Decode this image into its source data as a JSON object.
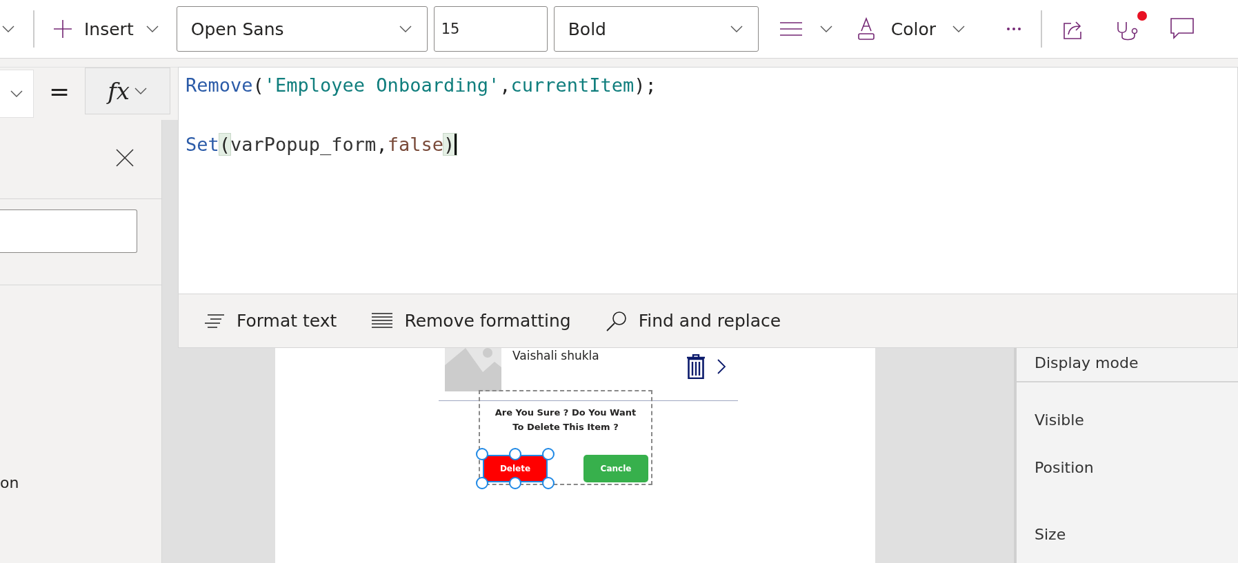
{
  "toolbar": {
    "insert_label": "Insert",
    "font": "Open Sans",
    "font_size": "15",
    "font_weight": "Bold",
    "color_label": "Color",
    "health_notification": true
  },
  "formula_bar": {
    "equals": "=",
    "fx": "fx",
    "lines": [
      {
        "tokens": [
          {
            "kind": "function",
            "text": "Remove"
          },
          {
            "kind": "punct",
            "text": "("
          },
          {
            "kind": "string",
            "text": "'Employee Onboarding'"
          },
          {
            "kind": "punct",
            "text": ","
          },
          {
            "kind": "identifier",
            "text": "currentItem"
          },
          {
            "kind": "punct",
            "text": ");"
          }
        ]
      },
      {
        "tokens": [
          {
            "kind": "function",
            "text": "Set"
          },
          {
            "kind": "bracket",
            "text": "("
          },
          {
            "kind": "variable",
            "text": "varPopup_form"
          },
          {
            "kind": "punct",
            "text": ","
          },
          {
            "kind": "keyword",
            "text": "false"
          },
          {
            "kind": "bracket",
            "text": ")",
            "caret": true
          }
        ]
      }
    ],
    "actions": [
      {
        "kind": "format",
        "label": "Format text"
      },
      {
        "kind": "remove",
        "label": "Remove formatting"
      },
      {
        "kind": "find",
        "label": "Find and replace"
      }
    ]
  },
  "left_panel": {
    "text": "on"
  },
  "screen": {
    "item_title": "Vaishali shukla",
    "popup": {
      "message": "Are You Sure ? Do You Want To Delete This Item ?",
      "buttons": [
        {
          "label": "Delete",
          "selected": true,
          "color": "#ff0000"
        },
        {
          "label": "Cancle",
          "selected": false,
          "color": "#37b04c"
        }
      ]
    }
  },
  "right_panel": {
    "properties": [
      "Display mode",
      "Visible",
      "Position",
      "Size"
    ]
  }
}
